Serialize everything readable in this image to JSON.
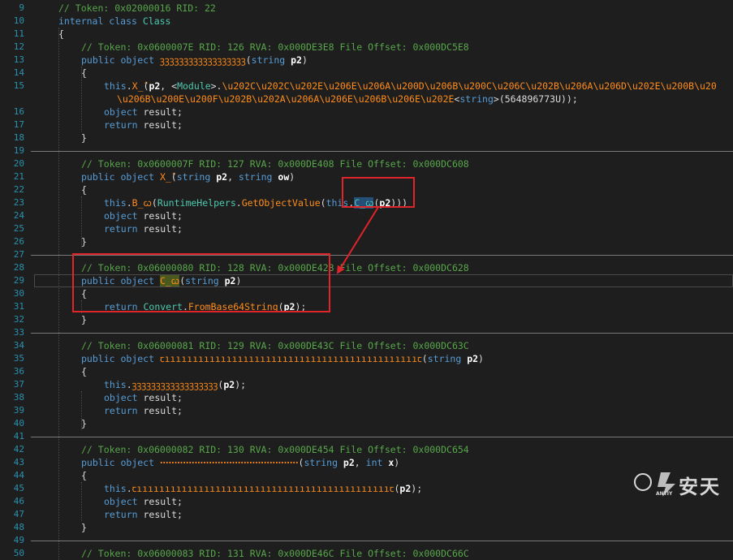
{
  "lines": [
    {
      "n": "9",
      "indent": 0,
      "code": [
        {
          "c": "c",
          "t": "// Token: 0x02000016 RID: 22"
        }
      ]
    },
    {
      "n": "10",
      "indent": 0,
      "code": [
        {
          "c": "k",
          "t": "internal class "
        },
        {
          "c": "t",
          "t": "Class"
        }
      ]
    },
    {
      "n": "11",
      "indent": 0,
      "code": [
        {
          "c": "txt",
          "t": "{"
        }
      ]
    },
    {
      "n": "12",
      "indent": 1,
      "code": [
        {
          "c": "c",
          "t": "// Token: 0x0600007E RID: 126 RVA: 0x000DE3E8 File Offset: 0x000DC5E8"
        }
      ]
    },
    {
      "n": "13",
      "indent": 1,
      "code": [
        {
          "c": "k",
          "t": "public "
        },
        {
          "c": "k",
          "t": "object "
        },
        {
          "c": "m",
          "t": "ꝫꝫꝫꝫꝫꝫꝫꝫꝫꝫꝫꝫꝫꝫꝫꝫꝫꝫ"
        },
        {
          "c": "txt",
          "t": "("
        },
        {
          "c": "k",
          "t": "string "
        },
        {
          "c": "p",
          "t": "p2"
        },
        {
          "c": "txt",
          "t": ")"
        }
      ]
    },
    {
      "n": "14",
      "indent": 1,
      "code": [
        {
          "c": "txt",
          "t": "{"
        }
      ]
    },
    {
      "n": "15",
      "indent": 2,
      "code": [
        {
          "c": "k",
          "t": "this"
        },
        {
          "c": "txt",
          "t": "."
        },
        {
          "c": "m",
          "t": "X_̂"
        },
        {
          "c": "txt",
          "t": "("
        },
        {
          "c": "p",
          "t": "p2"
        },
        {
          "c": "txt",
          "t": ", <"
        },
        {
          "c": "t",
          "t": "Module"
        },
        {
          "c": "txt",
          "t": ">."
        },
        {
          "c": "m",
          "t": "\\u202C\\u202C\\u202E\\u206E\\u206A\\u200D\\u206B\\u200C\\u206C\\u202B\\u206A\\u206D\\u202E\\u200B\\u20"
        }
      ]
    },
    {
      "n": "",
      "indent": 2,
      "cont": true,
      "code": [
        {
          "c": "m",
          "t": "\\u206B\\u200E\\u200F\\u202B\\u202A\\u206A\\u206E\\u206B\\u206E\\u202E"
        },
        {
          "c": "txt",
          "t": "<"
        },
        {
          "c": "k",
          "t": "string"
        },
        {
          "c": "txt",
          "t": ">(564896773U));"
        }
      ]
    },
    {
      "n": "16",
      "indent": 2,
      "code": [
        {
          "c": "k",
          "t": "object "
        },
        {
          "c": "txt",
          "t": "result;"
        }
      ]
    },
    {
      "n": "17",
      "indent": 2,
      "code": [
        {
          "c": "k",
          "t": "return "
        },
        {
          "c": "txt",
          "t": "result;"
        }
      ]
    },
    {
      "n": "18",
      "indent": 1,
      "code": [
        {
          "c": "txt",
          "t": "}"
        }
      ]
    },
    {
      "n": "19",
      "indent": 0,
      "code": []
    },
    {
      "n": "20",
      "indent": 1,
      "code": [
        {
          "c": "c",
          "t": "// Token: 0x0600007F RID: 127 RVA: 0x000DE408 File Offset: 0x000DC608"
        }
      ]
    },
    {
      "n": "21",
      "indent": 1,
      "code": [
        {
          "c": "k",
          "t": "public "
        },
        {
          "c": "k",
          "t": "object "
        },
        {
          "c": "m",
          "t": "X_̂"
        },
        {
          "c": "txt",
          "t": "("
        },
        {
          "c": "k",
          "t": "string "
        },
        {
          "c": "p",
          "t": "p2"
        },
        {
          "c": "txt",
          "t": ", "
        },
        {
          "c": "k",
          "t": "string "
        },
        {
          "c": "p",
          "t": "ow"
        },
        {
          "c": "txt",
          "t": ")"
        }
      ]
    },
    {
      "n": "22",
      "indent": 1,
      "code": [
        {
          "c": "txt",
          "t": "{"
        }
      ]
    },
    {
      "n": "23",
      "indent": 2,
      "code": [
        {
          "c": "k",
          "t": "this"
        },
        {
          "c": "txt",
          "t": "."
        },
        {
          "c": "m",
          "t": "B_ꞷ"
        },
        {
          "c": "txt",
          "t": "("
        },
        {
          "c": "t",
          "t": "RuntimeHelpers"
        },
        {
          "c": "txt",
          "t": "."
        },
        {
          "c": "m",
          "t": "GetObjectValue"
        },
        {
          "c": "txt",
          "t": "("
        },
        {
          "c": "k",
          "t": "this"
        },
        {
          "c": "txt",
          "t": "."
        },
        {
          "c": "hl-sel",
          "t": "C_ꞷ"
        },
        {
          "c": "txt",
          "t": "("
        },
        {
          "c": "p",
          "t": "p2"
        },
        {
          "c": "txt",
          "t": ")))"
        }
      ]
    },
    {
      "n": "24",
      "indent": 2,
      "code": [
        {
          "c": "k",
          "t": "object "
        },
        {
          "c": "txt",
          "t": "result;"
        }
      ]
    },
    {
      "n": "25",
      "indent": 2,
      "code": [
        {
          "c": "k",
          "t": "return "
        },
        {
          "c": "txt",
          "t": "result;"
        }
      ]
    },
    {
      "n": "26",
      "indent": 1,
      "code": [
        {
          "c": "txt",
          "t": "}"
        }
      ]
    },
    {
      "n": "27",
      "indent": 0,
      "code": []
    },
    {
      "n": "28",
      "indent": 1,
      "code": [
        {
          "c": "c",
          "t": "// Token: 0x06000080 RID: 128 RVA: 0x000DE428 File Offset: 0x000DC628"
        }
      ]
    },
    {
      "n": "29",
      "indent": 1,
      "code": [
        {
          "c": "k",
          "t": "public "
        },
        {
          "c": "k",
          "t": "object "
        },
        {
          "c": "hl-ref",
          "t": "C_ꞷ"
        },
        {
          "c": "txt",
          "t": "("
        },
        {
          "c": "k",
          "t": "string "
        },
        {
          "c": "p",
          "t": "p2"
        },
        {
          "c": "txt",
          "t": ")"
        }
      ]
    },
    {
      "n": "30",
      "indent": 1,
      "code": [
        {
          "c": "txt",
          "t": "{"
        }
      ]
    },
    {
      "n": "31",
      "indent": 2,
      "code": [
        {
          "c": "k",
          "t": "return "
        },
        {
          "c": "t",
          "t": "Convert"
        },
        {
          "c": "txt",
          "t": "."
        },
        {
          "c": "m",
          "t": "FromBase64String"
        },
        {
          "c": "txt",
          "t": "("
        },
        {
          "c": "p",
          "t": "p2"
        },
        {
          "c": "txt",
          "t": ");"
        }
      ]
    },
    {
      "n": "32",
      "indent": 1,
      "code": [
        {
          "c": "txt",
          "t": "}"
        }
      ]
    },
    {
      "n": "33",
      "indent": 0,
      "code": []
    },
    {
      "n": "34",
      "indent": 1,
      "code": [
        {
          "c": "c",
          "t": "// Token: 0x06000081 RID: 129 RVA: 0x000DE43C File Offset: 0x000DC63C"
        }
      ]
    },
    {
      "n": "35",
      "indent": 1,
      "code": [
        {
          "c": "k",
          "t": "public "
        },
        {
          "c": "k",
          "t": "object "
        },
        {
          "c": "m",
          "t": "ꞇıııııııııııııııııııııııııııııııııııııııııııııꞇ"
        },
        {
          "c": "txt",
          "t": "("
        },
        {
          "c": "k",
          "t": "string "
        },
        {
          "c": "p",
          "t": "p2"
        },
        {
          "c": "txt",
          "t": ")"
        }
      ]
    },
    {
      "n": "36",
      "indent": 1,
      "code": [
        {
          "c": "txt",
          "t": "{"
        }
      ]
    },
    {
      "n": "37",
      "indent": 2,
      "code": [
        {
          "c": "k",
          "t": "this"
        },
        {
          "c": "txt",
          "t": "."
        },
        {
          "c": "m",
          "t": "ꝫꝫꝫꝫꝫꝫꝫꝫꝫꝫꝫꝫꝫꝫꝫꝫꝫꝫ"
        },
        {
          "c": "txt",
          "t": "("
        },
        {
          "c": "p",
          "t": "p2"
        },
        {
          "c": "txt",
          "t": ");"
        }
      ]
    },
    {
      "n": "38",
      "indent": 2,
      "code": [
        {
          "c": "k",
          "t": "object "
        },
        {
          "c": "txt",
          "t": "result;"
        }
      ]
    },
    {
      "n": "39",
      "indent": 2,
      "code": [
        {
          "c": "k",
          "t": "return "
        },
        {
          "c": "txt",
          "t": "result;"
        }
      ]
    },
    {
      "n": "40",
      "indent": 1,
      "code": [
        {
          "c": "txt",
          "t": "}"
        }
      ]
    },
    {
      "n": "41",
      "indent": 0,
      "code": []
    },
    {
      "n": "42",
      "indent": 1,
      "code": [
        {
          "c": "c",
          "t": "// Token: 0x06000082 RID: 130 RVA: 0x000DE454 File Offset: 0x000DC654"
        }
      ]
    },
    {
      "n": "43",
      "indent": 1,
      "code": [
        {
          "c": "k",
          "t": "public "
        },
        {
          "c": "k",
          "t": "object "
        },
        {
          "c": "m",
          "t": "ꞏꞏꞏꞏꞏꞏꞏꞏꞏꞏꞏꞏꞏꞏꞏꞏꞏꞏꞏꞏꞏꞏꞏꞏꞏꞏꞏꞏꞏꞏꞏꞏꞏꞏꞏꞏꞏꞏꞏꞏꞏꞏꞏꞏꞏꞏꞏꞏ"
        },
        {
          "c": "txt",
          "t": "("
        },
        {
          "c": "k",
          "t": "string "
        },
        {
          "c": "p",
          "t": "p2"
        },
        {
          "c": "txt",
          "t": ", "
        },
        {
          "c": "k",
          "t": "int "
        },
        {
          "c": "p",
          "t": "x"
        },
        {
          "c": "txt",
          "t": ")"
        }
      ]
    },
    {
      "n": "44",
      "indent": 1,
      "code": [
        {
          "c": "txt",
          "t": "{"
        }
      ]
    },
    {
      "n": "45",
      "indent": 2,
      "code": [
        {
          "c": "k",
          "t": "this"
        },
        {
          "c": "txt",
          "t": "."
        },
        {
          "c": "m",
          "t": "ꞇıııııııııııııııııııııııııııııııııııııııııııııꞇ"
        },
        {
          "c": "txt",
          "t": "("
        },
        {
          "c": "p",
          "t": "p2"
        },
        {
          "c": "txt",
          "t": ");"
        }
      ]
    },
    {
      "n": "46",
      "indent": 2,
      "code": [
        {
          "c": "k",
          "t": "object "
        },
        {
          "c": "txt",
          "t": "result;"
        }
      ]
    },
    {
      "n": "47",
      "indent": 2,
      "code": [
        {
          "c": "k",
          "t": "return "
        },
        {
          "c": "txt",
          "t": "result;"
        }
      ]
    },
    {
      "n": "48",
      "indent": 1,
      "code": [
        {
          "c": "txt",
          "t": "}"
        }
      ]
    },
    {
      "n": "49",
      "indent": 0,
      "code": []
    },
    {
      "n": "50",
      "indent": 1,
      "code": [
        {
          "c": "c",
          "t": "// Token: 0x06000083 RID: 131 RVA: 0x000DE46C File Offset: 0x000DC66C"
        }
      ]
    }
  ],
  "annotations": {
    "highlight_color": "#e0242a",
    "arrow_from": "call-site C_ꞷ(p2) on line 23",
    "arrow_to": "method definition C_ꞷ on line 29"
  },
  "watermark": {
    "copyright_symbol": "©",
    "brand_text": "安天",
    "logo_text": "ANTIY"
  }
}
